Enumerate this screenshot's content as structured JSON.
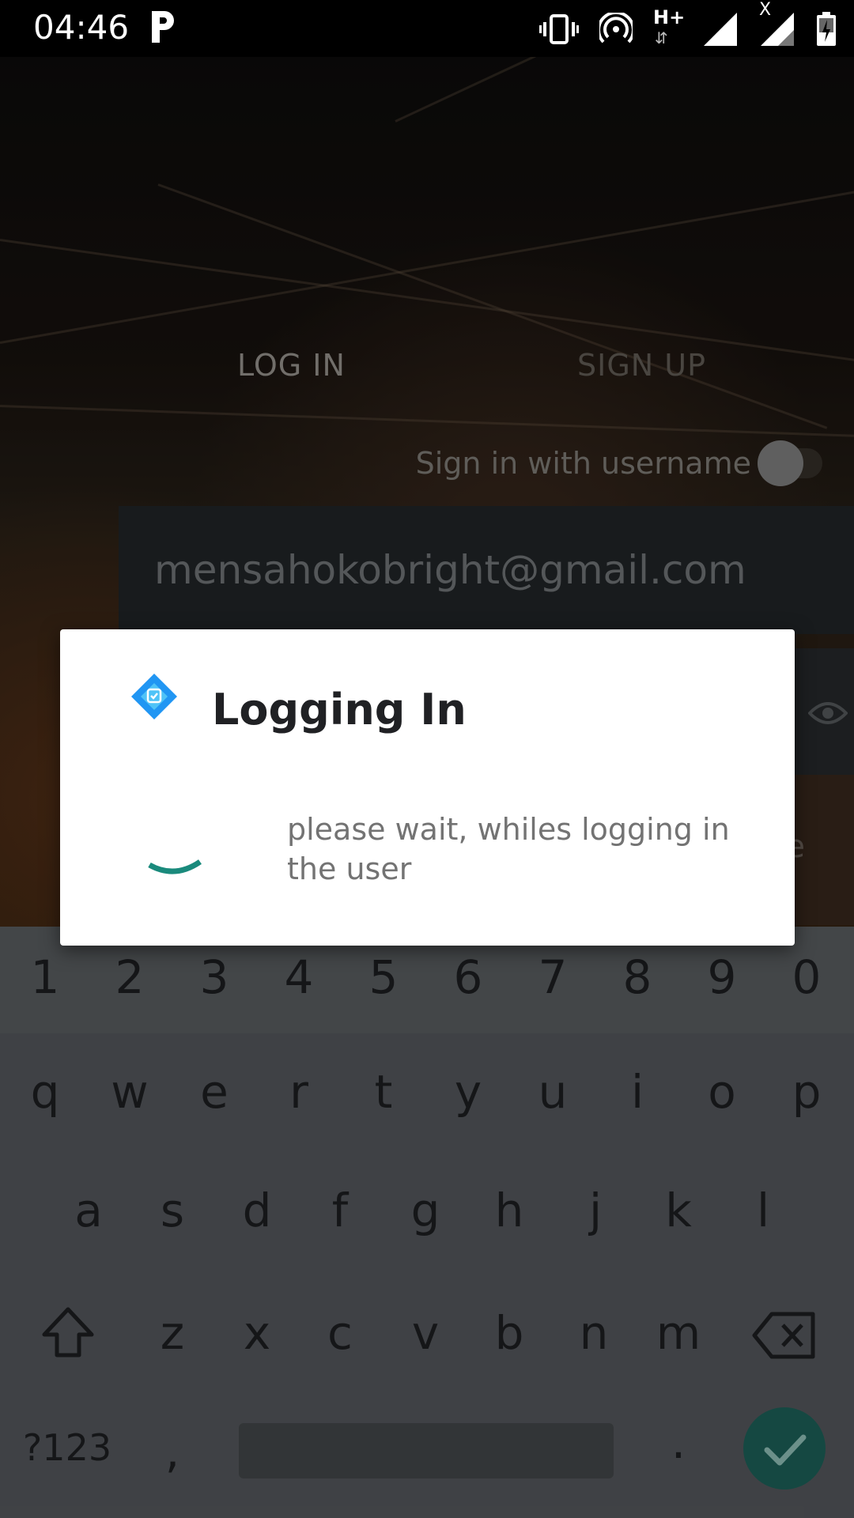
{
  "status_bar": {
    "time": "04:46",
    "icons": [
      "parking-icon",
      "vibrate-icon",
      "hotspot-icon",
      "hplus-data-icon",
      "signal-icon",
      "signal-noservice-icon",
      "battery-charging-icon"
    ],
    "network_label": "H+",
    "noservice_mark": "X"
  },
  "login_screen": {
    "tabs": [
      {
        "label": "LOG IN",
        "active": true
      },
      {
        "label": "SIGN UP",
        "active": false
      }
    ],
    "switch_label": "Sign in with username",
    "switch_on": false,
    "email_value": "mensahokobright@gmail.com",
    "button_partial_text": "e"
  },
  "dialog": {
    "title": "Logging In",
    "message": "please wait, whiles logging in the user",
    "icon": "app-logo-icon",
    "spinner_color": "#1a8a7c"
  },
  "keyboard": {
    "number_row": [
      "1",
      "2",
      "3",
      "4",
      "5",
      "6",
      "7",
      "8",
      "9",
      "0"
    ],
    "row1": [
      "q",
      "w",
      "e",
      "r",
      "t",
      "y",
      "u",
      "i",
      "o",
      "p"
    ],
    "row2": [
      "a",
      "s",
      "d",
      "f",
      "g",
      "h",
      "j",
      "k",
      "l"
    ],
    "row3": [
      "z",
      "x",
      "c",
      "v",
      "b",
      "n",
      "m"
    ],
    "symbols_key": "?123",
    "comma_key": ",",
    "period_key": ".",
    "enter_icon": "check-icon",
    "enter_color": "#1f6b62"
  }
}
